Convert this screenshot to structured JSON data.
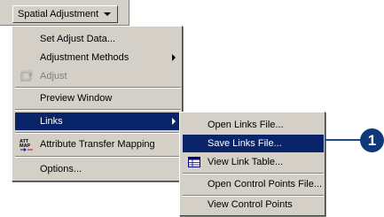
{
  "toolbar": {
    "title": "Spatial Adjustment"
  },
  "menu": {
    "items": [
      {
        "label": "Set Adjust Data...",
        "icon": ""
      },
      {
        "label": "Adjustment Methods",
        "icon": "",
        "submenu": true
      },
      {
        "label": "Adjust",
        "icon": "adjust-icon",
        "disabled": true
      },
      {
        "label": "Preview Window",
        "icon": ""
      },
      {
        "label": "Links",
        "icon": "",
        "submenu": true,
        "highlighted": true
      },
      {
        "label": "Attribute Transfer Mapping",
        "icon": "attribute-transfer-icon",
        "icon_text": [
          "ATT",
          "MAP"
        ]
      },
      {
        "label": "Options...",
        "icon": ""
      }
    ]
  },
  "links_submenu": {
    "items": [
      {
        "label": "Open Links File..."
      },
      {
        "label": "Save Links File...",
        "highlighted": true
      },
      {
        "label": "View Link Table...",
        "icon": "link-table-icon"
      },
      {
        "label": "Open Control Points File..."
      },
      {
        "label": "View Control Points"
      }
    ]
  },
  "callout": {
    "number": "1"
  },
  "colors": {
    "menu_bg": "#d4d0c8",
    "highlight": "#0a246a",
    "callout": "#0e3a7a"
  }
}
